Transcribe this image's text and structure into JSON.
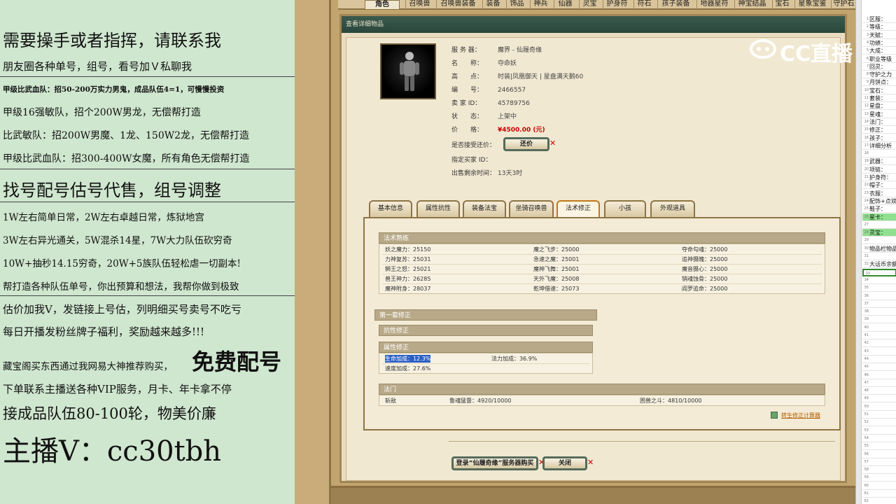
{
  "left_panel": {
    "lines": [
      "需要操手或者指挥，请联系我",
      "朋友圈各种单号，组号，看号加Ｖ私聊我",
      "甲级比武血队：招50-200万实力男鬼，成品队伍4=1，可慢慢投资",
      "甲级16强敏队，招个200W男龙，无偿帮打造",
      "比武敏队：招200W男魔、1龙、150W2龙，无偿帮打造",
      "甲级比武血队：招300-400W女魔，所有角色无偿帮打造",
      "找号配号估号代售，组号调整",
      "1W左右简单日常，2W左右卓越日常，炼狱地宫",
      "3W左右异光通关，5W混杀14星，7W大力队伍砍穷奇",
      "10W+抽秒14.15穷奇，20W+5族队伍轻松虐一切副本!",
      "帮打造各种队伍单号，你出预算和想法，我帮你做到极致",
      "估价加我V，发链接上号估，列明细买号卖号不吃亏",
      "每日开播发粉丝牌子福利，奖励越来越多!!!",
      "藏宝阁买东西通过我网易大神推荐购买，",
      "免费配号",
      "下单联系主播送各种VIP服务，月卡、年卡拿不停",
      "接成品队伍80-100轮，物美价廉",
      "主播V：cc30tbh"
    ]
  },
  "game": {
    "top_tabs": [
      "角色",
      "召唤兽",
      "召唤兽装备",
      "装备",
      "饰品",
      "神兵",
      "仙器",
      "灵宝",
      "护身符",
      "符石",
      "孩子装备",
      "地器星符",
      "神宝结晶",
      "宝石",
      "星象宝鉴",
      "守护石"
    ],
    "dialog_title": "查看详细物品",
    "info": [
      {
        "key": "服 务 器：",
        "value": "魔界 - 仙履奇缘"
      },
      {
        "key": "名　　称：",
        "value": "夺命妖"
      },
      {
        "key": "高　　点：",
        "value": "时装|凤凰御天 | 星盘满天鹅60"
      },
      {
        "key": "编　　号：",
        "value": "2466557"
      },
      {
        "key": "卖 家 ID：",
        "value": "45789756"
      },
      {
        "key": "状　　态：",
        "value": "上架中"
      },
      {
        "key": "价　　格：",
        "value": "¥4500.00 (元)"
      },
      {
        "key": "是否接受还价：",
        "value": ""
      },
      {
        "key": "指定买家 ID：",
        "value": ""
      },
      {
        "key": "出售剩余时间：",
        "value": "13天3时"
      }
    ],
    "bargain_button": "还价",
    "sub_tabs": [
      "基本信息",
      "属性抗性",
      "装备法宝",
      "坐骑召唤兽",
      "法术修正",
      "小孩",
      "外观道具"
    ],
    "active_sub_tab": "法术修正",
    "spell_section": {
      "header": "法术熟练",
      "rows": [
        [
          "妖之魔力：25150",
          "魔之飞步：25000",
          "夺命勾魂：25000"
        ],
        [
          "力神复苏：25031",
          "急速之魔：25001",
          "追神摄魄：25000"
        ],
        [
          "狮王之怒：25021",
          "魔神飞舞：25001",
          "魔音摄心：25000"
        ],
        [
          "兽王神力：26285",
          "天外飞魔：25008",
          "销魂蚀骨：25000"
        ],
        [
          "魔神附身：28037",
          "乾坤借速：25073",
          "阎罗追命：25000"
        ]
      ]
    },
    "correction_header": "第一套修正",
    "resist_header": "抗性修正",
    "attr_header": "属性修正",
    "attr_rows": [
      [
        "生命加成：12.3%",
        "法力加成：36.9%"
      ],
      [
        "速度加成：27.6%",
        ""
      ]
    ],
    "fabao_header": "法门",
    "fabao_row": [
      "斩敌",
      "鲁魂猛督：4920/10000",
      "困兽之斗：4810/10000"
    ],
    "calc_link": "转生修正计算器",
    "login_button": "登录“仙履奇缘”服务器购买",
    "close_button": "关闭"
  },
  "watermark": "CC直播",
  "sheet": {
    "rows": [
      {
        "n": "1",
        "label": "区服："
      },
      {
        "n": "2",
        "label": "等级："
      },
      {
        "n": "3",
        "label": "天赋："
      },
      {
        "n": "4",
        "label": "功绩："
      },
      {
        "n": "5",
        "label": "大成："
      },
      {
        "n": "6",
        "label": "职业等级"
      },
      {
        "n": "7",
        "label": "回灵："
      },
      {
        "n": "8",
        "label": "守护之力"
      },
      {
        "n": "9",
        "label": "月饼点："
      },
      {
        "n": "10",
        "label": "宝石："
      },
      {
        "n": "11",
        "label": "套装："
      },
      {
        "n": "12",
        "label": "星盘："
      },
      {
        "n": "13",
        "label": "星魂："
      },
      {
        "n": "14",
        "label": "法门："
      },
      {
        "n": "15",
        "label": "修正："
      },
      {
        "n": "16",
        "label": "孩子："
      },
      {
        "n": "17",
        "label": "详细分析"
      },
      {
        "n": "18",
        "label": ""
      },
      {
        "n": "19",
        "label": "武器："
      },
      {
        "n": "20",
        "label": "项链："
      },
      {
        "n": "21",
        "label": "护身符："
      },
      {
        "n": "22",
        "label": "帽子："
      },
      {
        "n": "23",
        "label": "衣服："
      },
      {
        "n": "24",
        "label": "配饰+点双"
      },
      {
        "n": "25",
        "label": "鞋子："
      },
      {
        "n": "26",
        "label": "星卡："
      },
      {
        "n": "27",
        "label": ""
      },
      {
        "n": "28",
        "label": "灵宝："
      },
      {
        "n": "29",
        "label": ""
      },
      {
        "n": "30",
        "label": "物品栏物品"
      },
      {
        "n": "31",
        "label": ""
      },
      {
        "n": "32",
        "label": "大话币余额"
      },
      {
        "n": "33",
        "label": ""
      },
      {
        "n": "34",
        "label": ""
      },
      {
        "n": "35",
        "label": ""
      },
      {
        "n": "36",
        "label": ""
      },
      {
        "n": "37",
        "label": ""
      },
      {
        "n": "38",
        "label": ""
      },
      {
        "n": "39",
        "label": ""
      },
      {
        "n": "40",
        "label": ""
      },
      {
        "n": "41",
        "label": ""
      },
      {
        "n": "42",
        "label": ""
      },
      {
        "n": "43",
        "label": ""
      },
      {
        "n": "44",
        "label": ""
      },
      {
        "n": "45",
        "label": ""
      },
      {
        "n": "46",
        "label": ""
      },
      {
        "n": "47",
        "label": ""
      },
      {
        "n": "48",
        "label": ""
      },
      {
        "n": "49",
        "label": ""
      },
      {
        "n": "50",
        "label": ""
      },
      {
        "n": "51",
        "label": ""
      },
      {
        "n": "52",
        "label": ""
      },
      {
        "n": "53",
        "label": ""
      },
      {
        "n": "54",
        "label": ""
      },
      {
        "n": "55",
        "label": ""
      },
      {
        "n": "56",
        "label": ""
      },
      {
        "n": "57",
        "label": ""
      },
      {
        "n": "58",
        "label": ""
      },
      {
        "n": "59",
        "label": ""
      },
      {
        "n": "60",
        "label": ""
      },
      {
        "n": "61",
        "label": ""
      },
      {
        "n": "62",
        "label": ""
      }
    ]
  },
  "colors": {
    "left_bg": "#cfe6cf",
    "game_frame": "#c2a56e",
    "dialog_header": "#2f4a40",
    "price_red": "#cc0000",
    "sheet_highlight": "#8fe08f"
  }
}
